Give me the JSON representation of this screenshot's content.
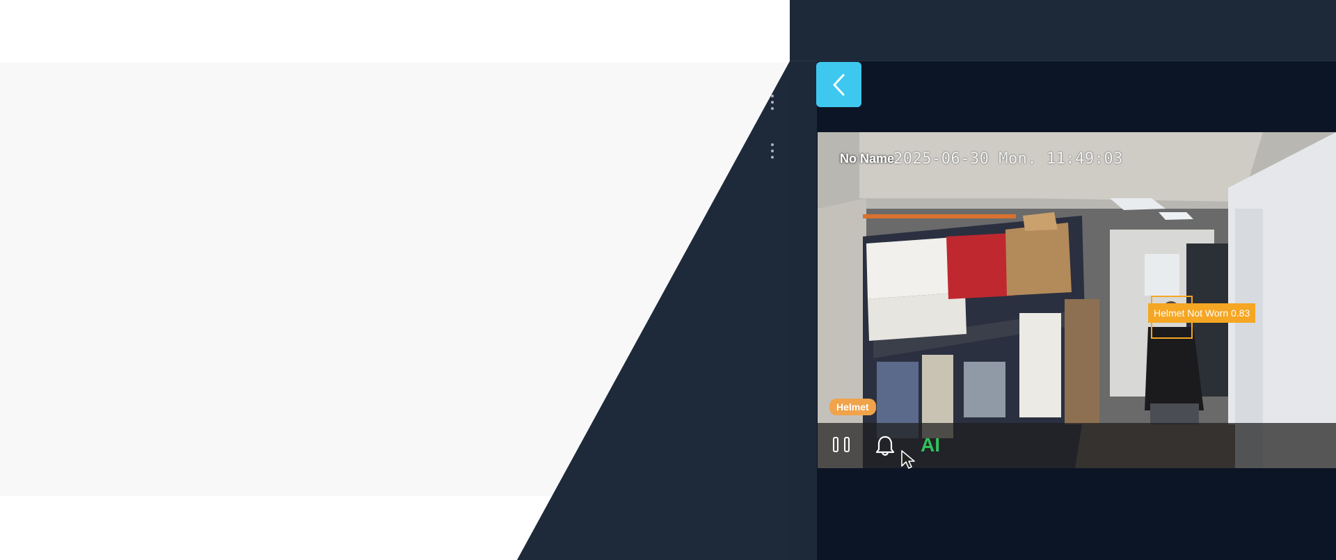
{
  "colors": {
    "accent": "#3ec8f0",
    "panel_bg": "#0c1525",
    "chrome_bg": "#1d2939",
    "detection_label_bg": "#f5a623",
    "ai_label": "#2fc35a"
  },
  "toolbar": {
    "back_icon": "chevron-left-icon"
  },
  "side_menu": {
    "menu_icon": "kebab-icon"
  },
  "camera": {
    "name": "No Name",
    "timestamp": "2025-06-30 Mon. 11:49:03",
    "detection_label": "Helmet Not Worn 0.83",
    "rule_badge": "Helmet"
  },
  "controls": {
    "pause_icon": "pause-icon",
    "alarm_icon": "bell-icon",
    "ai_label": "AI"
  }
}
